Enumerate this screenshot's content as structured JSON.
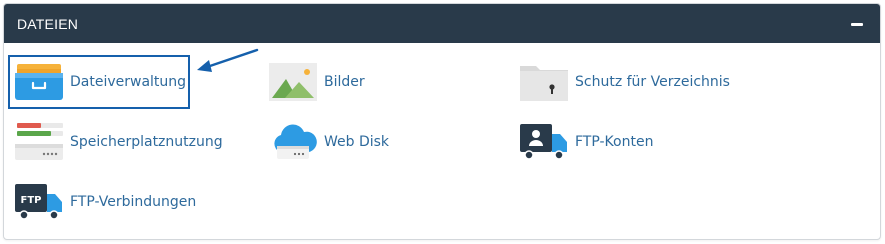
{
  "panel": {
    "title": "DATEIEN",
    "collapse_icon": "minus-icon"
  },
  "items": [
    {
      "label": "Dateiverwaltung",
      "icon": "file-manager-drawer-icon"
    },
    {
      "label": "Bilder",
      "icon": "images-icon"
    },
    {
      "label": "Schutz für Verzeichnis",
      "icon": "directory-privacy-folder-icon"
    },
    {
      "label": "Speicherplatznutzung",
      "icon": "disk-usage-icon"
    },
    {
      "label": "Web Disk",
      "icon": "web-disk-cloud-icon"
    },
    {
      "label": "FTP-Konten",
      "icon": "ftp-accounts-truck-icon"
    },
    {
      "label": "FTP-Verbindungen",
      "icon": "ftp-connections-truck-icon"
    }
  ],
  "annotation": {
    "highlighted_item": "Dateiverwaltung"
  },
  "colors": {
    "header_bg": "#293a4a",
    "link": "#2e6a9c",
    "highlight_border": "#1560ac"
  }
}
